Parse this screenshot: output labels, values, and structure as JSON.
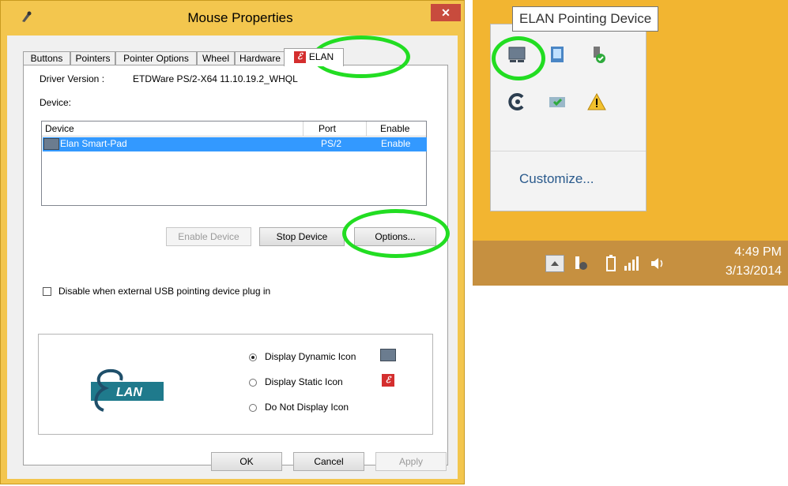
{
  "dialog": {
    "title": "Mouse Properties",
    "close_label": "✕",
    "tabs": [
      "Buttons",
      "Pointers",
      "Pointer Options",
      "Wheel",
      "Hardware",
      "ELAN"
    ],
    "driver_version_label": "Driver Version :",
    "driver_version_value": "ETDWare PS/2-X64 11.10.19.2_WHQL",
    "device_label": "Device:",
    "device_list": {
      "columns": [
        "Device",
        "Port",
        "Enable"
      ],
      "rows": [
        {
          "device": "Elan Smart-Pad",
          "port": "PS/2",
          "enable": "Enable"
        }
      ]
    },
    "buttons": {
      "enable_device": "Enable Device",
      "stop_device": "Stop Device",
      "options": "Options..."
    },
    "checkbox_disable_label": "Disable when external USB pointing device plug in",
    "icon_options": [
      {
        "label": "Display Dynamic Icon",
        "checked": true
      },
      {
        "label": "Display Static Icon",
        "checked": false
      },
      {
        "label": "Do Not Display Icon",
        "checked": false
      }
    ],
    "logo_text": "LAN",
    "footer": {
      "ok": "OK",
      "cancel": "Cancel",
      "apply": "Apply"
    }
  },
  "tray": {
    "tooltip": "ELAN Pointing Device",
    "customize_label": "Customize...",
    "clock_time": "4:49 PM",
    "clock_date": "3/13/2014"
  },
  "colors": {
    "dialog_frame": "#f3c64e",
    "close_button": "#c84b3d",
    "selection": "#3399ff",
    "highlight_ring": "#22dd22",
    "taskbar": "#c69040",
    "desktop": "#f2b531"
  }
}
